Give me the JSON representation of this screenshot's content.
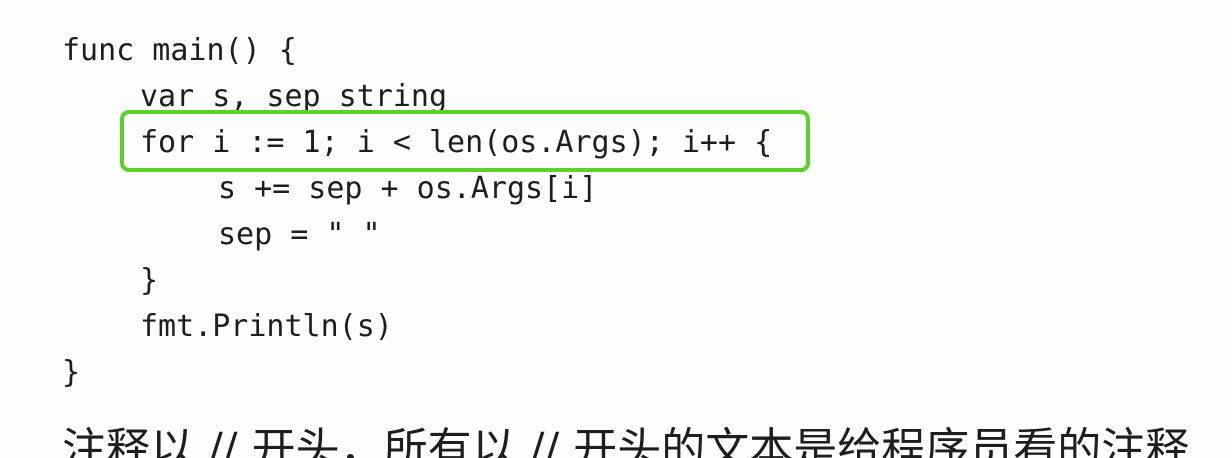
{
  "code": {
    "lines": [
      "func main() {",
      "var s, sep string",
      "for i := 1; i < len(os.Args); i++ {",
      "s += sep + os.Args[i]",
      "sep = \" \"",
      "}",
      "fmt.Println(s)",
      "}"
    ]
  },
  "highlight": {
    "color": "#5bd12a"
  },
  "prose": {
    "text": "注释以 // 开头，所有以 // 开头的文本是给程序员看的注释"
  }
}
